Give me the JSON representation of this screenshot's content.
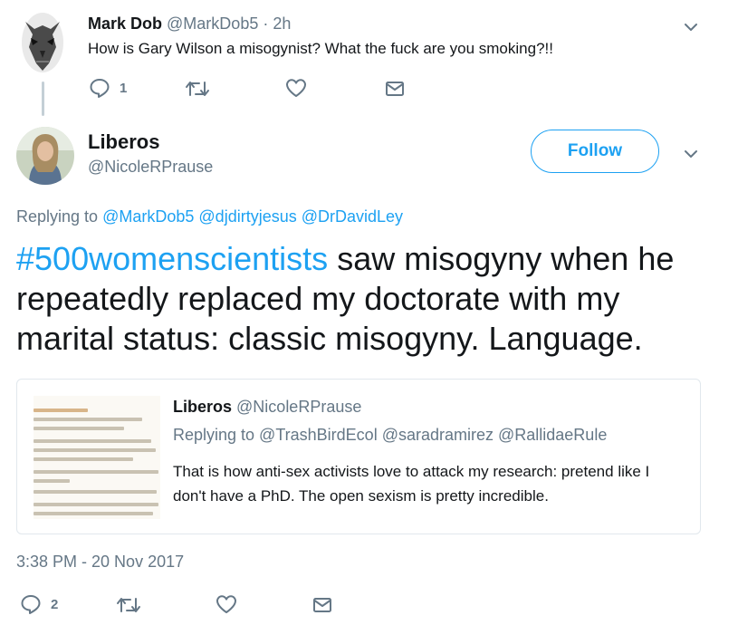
{
  "reply_tweet": {
    "author_name": "Mark Dob",
    "author_handle": "@MarkDob5",
    "age": "2h",
    "text": "How is Gary Wilson a misogynist? What the fuck are you smoking?!!",
    "reply_count": "1"
  },
  "main_tweet": {
    "author_name": "Liberos",
    "author_handle": "@NicoleRPrause",
    "follow_label": "Follow",
    "replying_prefix": "Replying to",
    "replying_mentions": [
      "@MarkDob5",
      "@djdirtyjesus",
      "@DrDavidLey"
    ],
    "hashtag": "#500womenscientists",
    "text": " saw misogyny when he repeatedly replaced my doctorate with my marital status: classic misogyny. Language.",
    "timestamp": "3:38 PM - 20 Nov 2017",
    "reply_count": "2"
  },
  "quoted_tweet": {
    "author_name": "Liberos",
    "author_handle": "@NicoleRPrause",
    "replying_line": "Replying to @TrashBirdEcol @saradramirez @RallidaeRule",
    "text": "That is how anti-sex activists love to attack my research: pretend like I don't have a PhD. The open sexism is pretty incredible."
  },
  "colors": {
    "accent": "#1da1f2",
    "muted": "#657786",
    "text": "#14171a",
    "border": "#e1e8ed"
  },
  "icons": [
    "reply-icon",
    "retweet-icon",
    "like-icon",
    "direct-message-icon",
    "chevron-down-icon"
  ]
}
